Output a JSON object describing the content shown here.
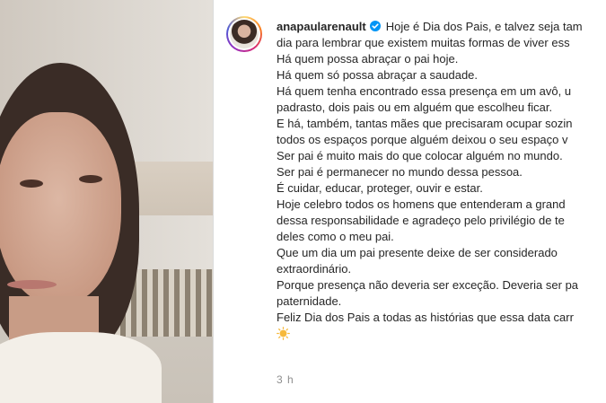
{
  "post": {
    "username": "anapaularenault",
    "caption_lines": [
      "Hoje é Dia dos Pais, e talvez seja tam",
      "dia para lembrar que existem muitas formas de viver ess",
      "Há quem possa abraçar o pai hoje.",
      "Há quem só possa abraçar a saudade.",
      "Há quem tenha encontrado essa presença em um avô, u",
      "padrasto, dois pais ou em alguém que escolheu ficar.",
      "E há, também, tantas mães que precisaram ocupar sozin",
      "todos os espaços porque alguém deixou o seu espaço v",
      "Ser pai é muito mais do que colocar alguém no mundo.",
      "Ser pai é permanecer no mundo dessa pessoa.",
      "É cuidar, educar, proteger, ouvir e estar.",
      "Hoje celebro todos os homens que entenderam a grand",
      "dessa responsabilidade e agradeço pelo privilégio de te",
      "deles como o meu pai.",
      "Que um dia um pai presente deixe de ser considerado",
      "extraordinário.",
      "Porque presença não deveria ser exceção. Deveria ser pa",
      "paternidade.",
      "Feliz Dia dos Pais a todas as histórias que essa data carr"
    ],
    "time_ago": "3 h",
    "emoji": "sun-icon"
  },
  "colors": {
    "verified": "#0095f6",
    "text": "#262626",
    "muted": "#8e8e8e"
  }
}
